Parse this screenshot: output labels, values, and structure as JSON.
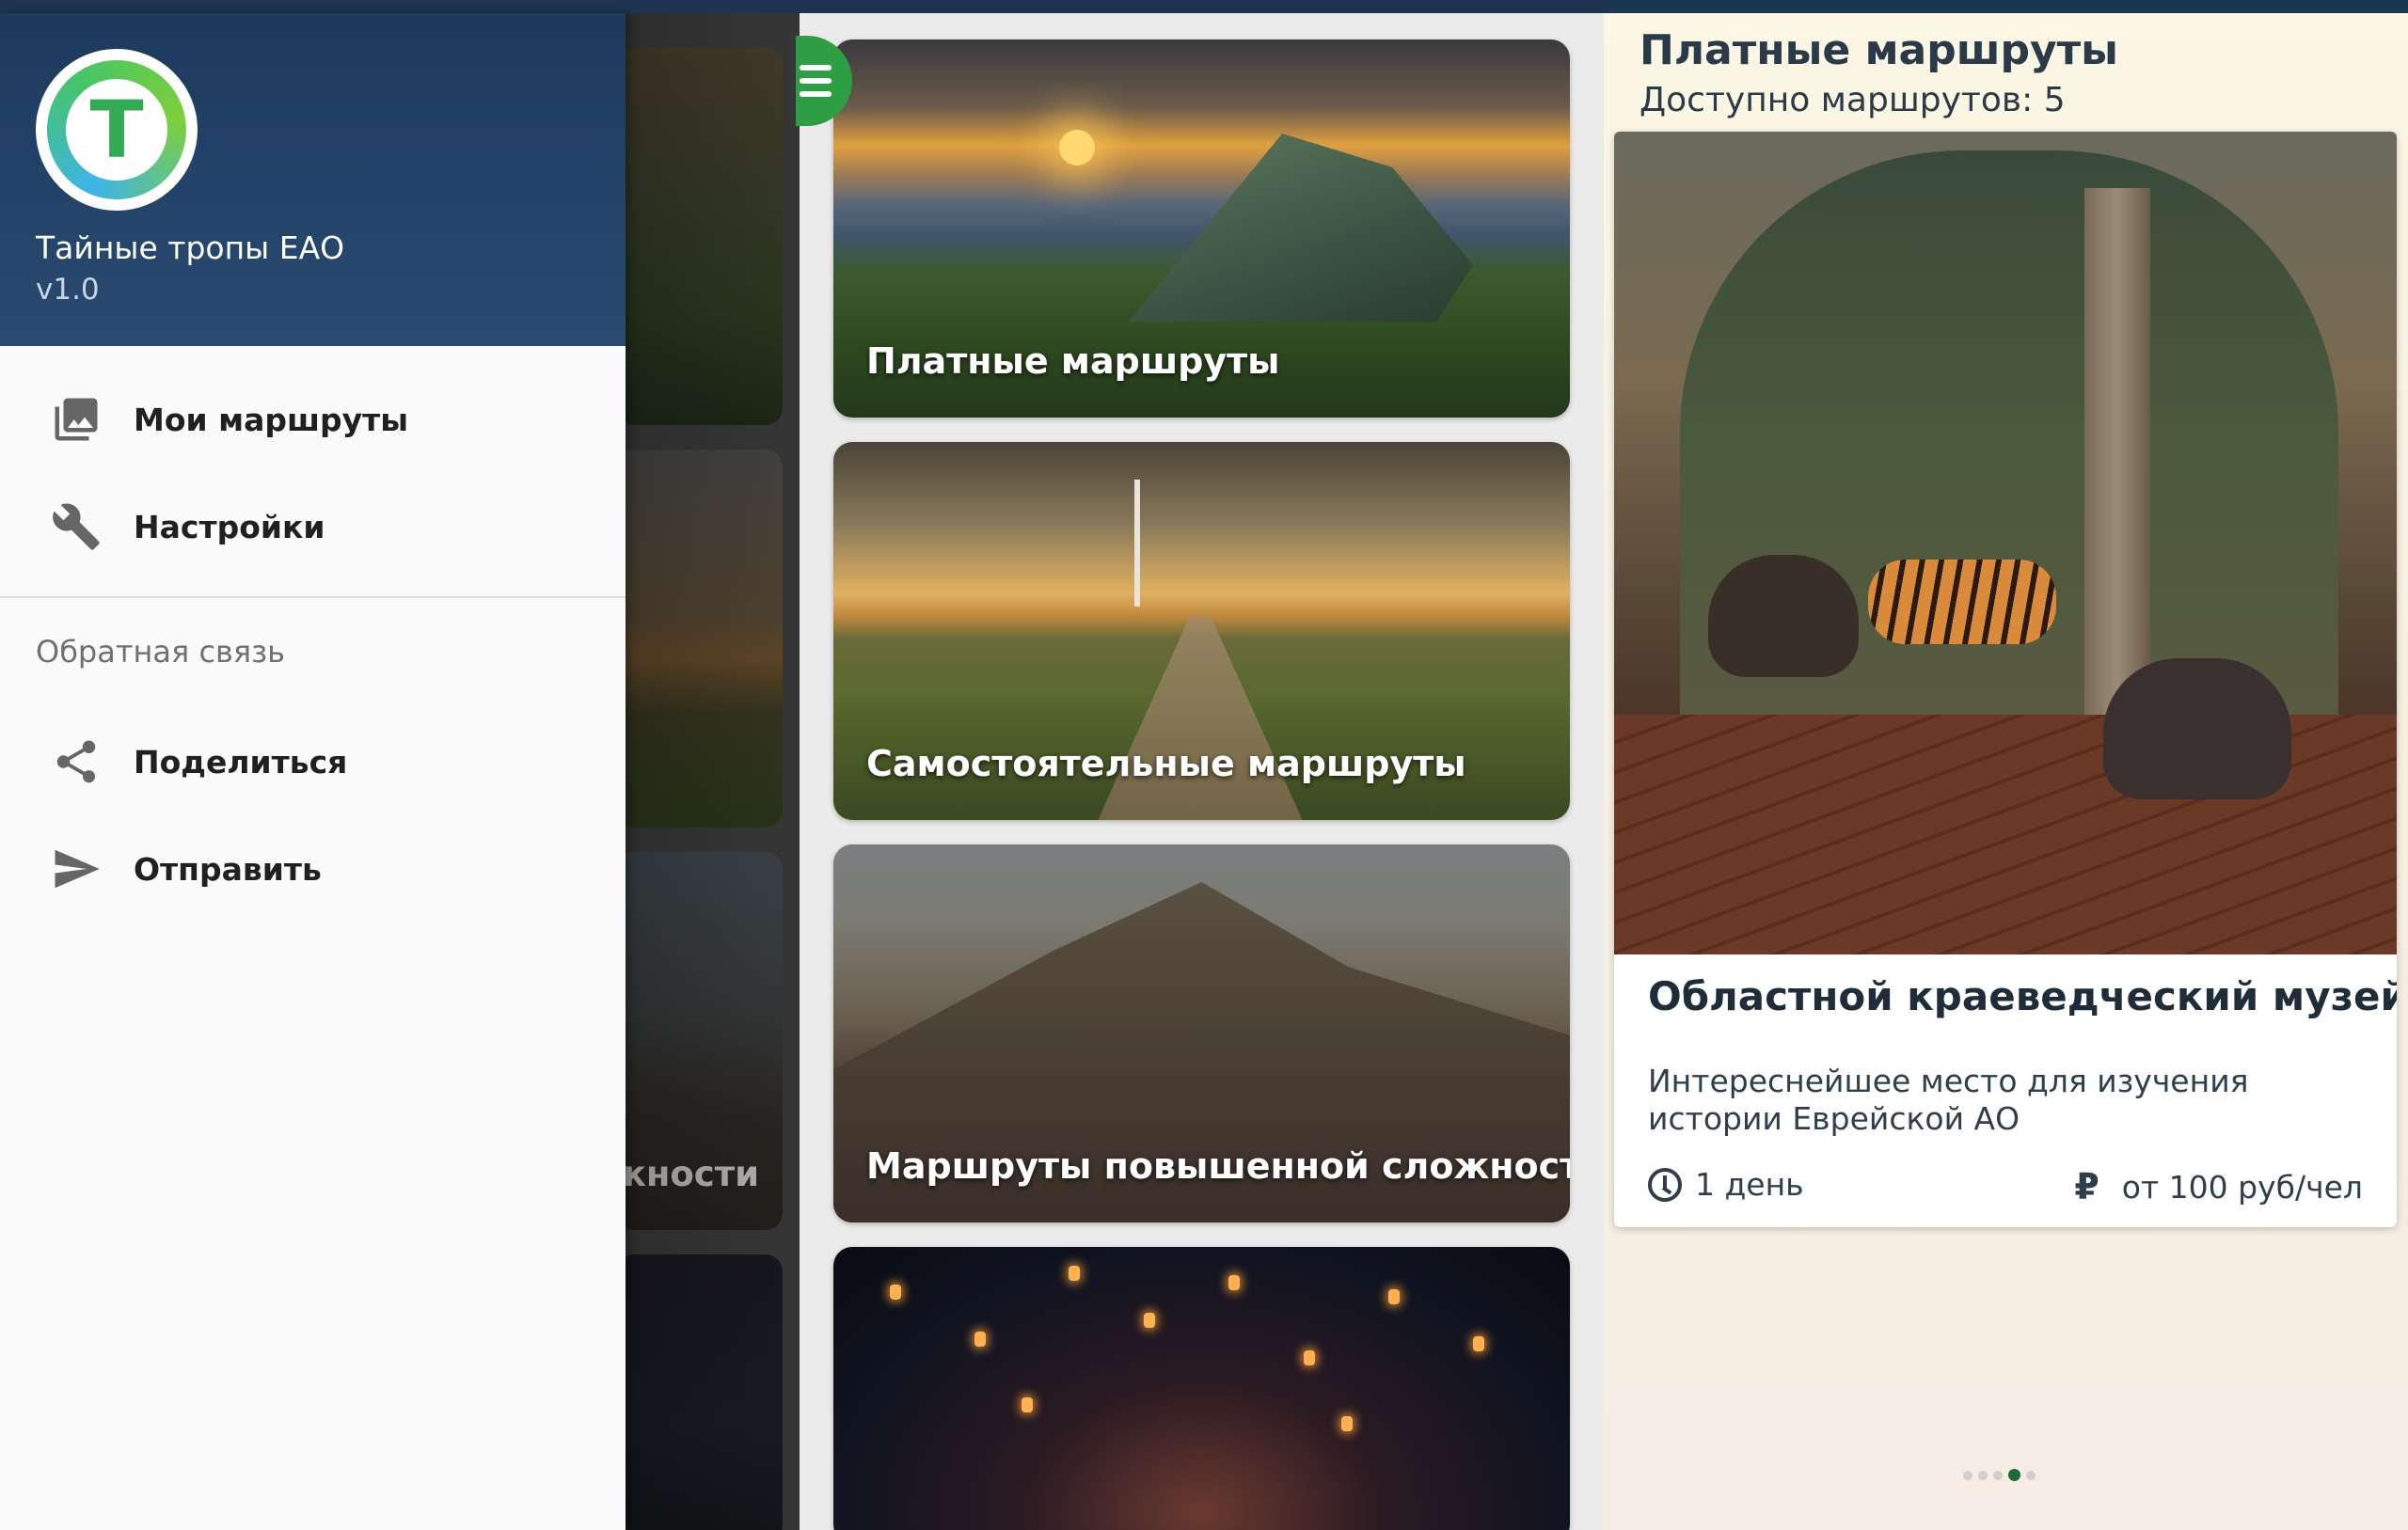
{
  "app": {
    "name": "Тайные тропы ЕАО",
    "version": "v1.0",
    "logo_letter": "T"
  },
  "drawer": {
    "items": [
      {
        "label": "Мои маршруты",
        "icon": "photo-library-icon"
      },
      {
        "label": "Настройки",
        "icon": "wrench-icon"
      }
    ],
    "section_title": "Обратная связь",
    "section_items": [
      {
        "label": "Поделиться",
        "icon": "share-icon"
      },
      {
        "label": "Отправить",
        "icon": "send-icon"
      }
    ]
  },
  "background_cards": {
    "partial_label": "жности"
  },
  "categories": [
    {
      "title": "Платные маршруты"
    },
    {
      "title": "Самостоятельные маршруты"
    },
    {
      "title": "Маршруты повышенной сложности"
    },
    {
      "title": ""
    }
  ],
  "detail": {
    "title": "Платные маршруты",
    "subtitle": "Доступно маршрутов: 5",
    "tour": {
      "name": "Областной краеведческий музей",
      "description": "Интереснейшее место для изучения истории Еврейской АО",
      "duration": "1 день",
      "price": "от 100 руб/чел",
      "currency_symbol": "₽"
    },
    "pager": {
      "count": 5,
      "active_index": 3
    }
  },
  "colors": {
    "drawer_header": "#1c3a5e",
    "fab": "#2e9e44",
    "accent_dark_green": "#1f6a3a"
  }
}
